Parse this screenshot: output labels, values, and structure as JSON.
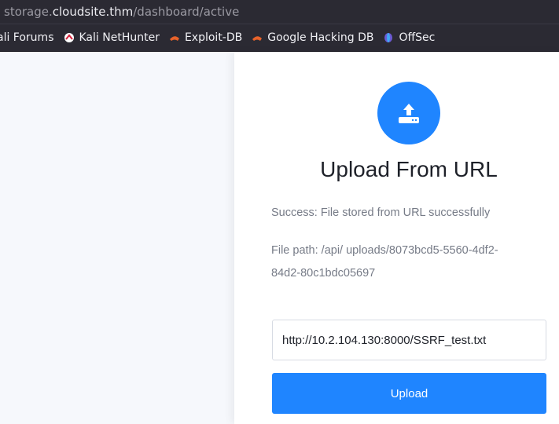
{
  "browser": {
    "url_prefix": "storage.",
    "url_host": "cloudsite.thm",
    "url_path": "/dashboard/active",
    "bookmarks": [
      {
        "label": "ali Forums",
        "icon": "kali-icon"
      },
      {
        "label": "Kali NetHunter",
        "icon": "nethunter-icon"
      },
      {
        "label": "Exploit-DB",
        "icon": "exploitdb-icon"
      },
      {
        "label": "Google Hacking DB",
        "icon": "ghdb-icon"
      },
      {
        "label": "OffSec",
        "icon": "offsec-icon"
      }
    ]
  },
  "panel": {
    "icon": "upload-icon",
    "title": "Upload From URL",
    "status": "Success: File stored from URL successfully",
    "file_path": "File path: /api/ uploads/8073bcd5-5560-4df2-84d2-80c1bdc05697",
    "url_value": "http://10.2.104.130:8000/SSRF_test.txt",
    "upload_label": "Upload"
  },
  "colors": {
    "accent": "#1f85ff",
    "toolbar": "#2b2a33"
  }
}
